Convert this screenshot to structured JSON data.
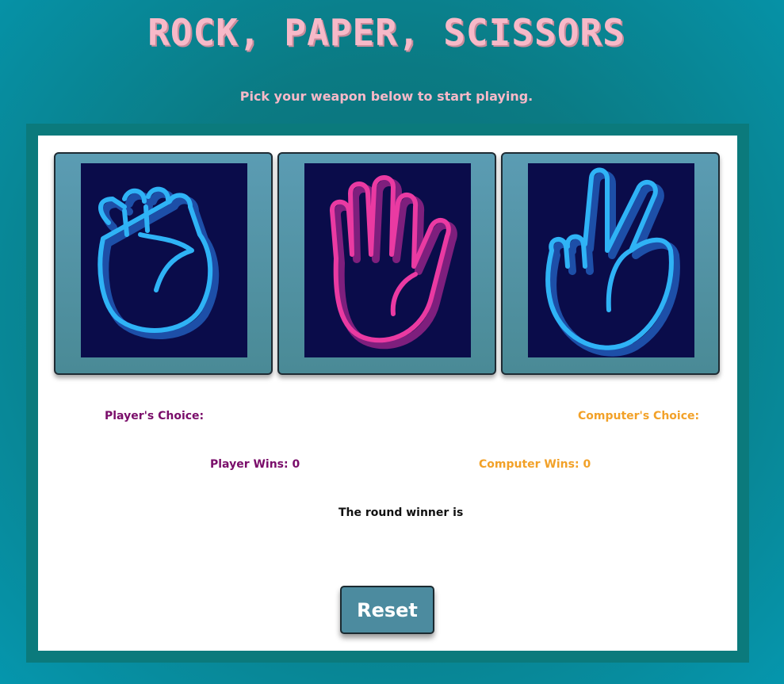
{
  "title": "ROCK, PAPER, SCISSORS",
  "subtitle": "Pick your weapon below to start playing.",
  "choices": [
    {
      "name": "rock",
      "icon": "fist-icon",
      "color": "#2fb3f6"
    },
    {
      "name": "paper",
      "icon": "open-hand-icon",
      "color": "#ea3aa2"
    },
    {
      "name": "scissors",
      "icon": "victory-hand-icon",
      "color": "#2fb3f6"
    }
  ],
  "scoreboard": {
    "player_choice_label": "Player's Choice:",
    "computer_choice_label": "Computer's Choice:",
    "player_wins_label": "Player Wins: 0",
    "computer_wins_label": "Computer Wins: 0",
    "round_winner_label": "The round winner is"
  },
  "reset_label": "Reset",
  "colors": {
    "title_pink": "#f7b9c8",
    "card_bg": "#4f92a4",
    "image_bg": "#0a0c4a",
    "player_purple": "#7a0d6a",
    "computer_orange": "#f2a128"
  }
}
